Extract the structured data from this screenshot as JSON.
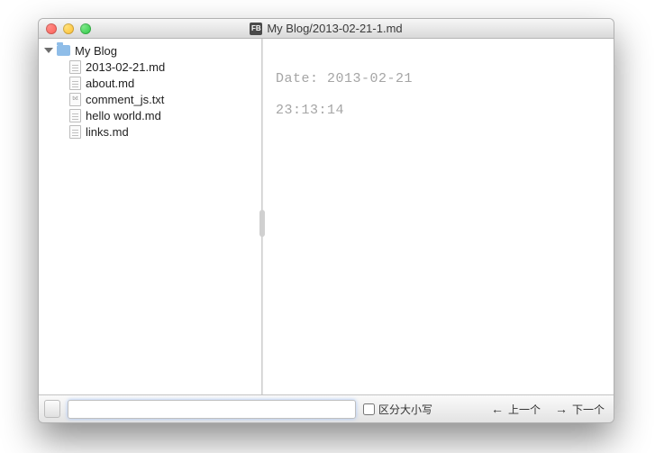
{
  "window": {
    "title": "My Blog/2013-02-21-1.md"
  },
  "tree": {
    "root": {
      "label": "My Blog"
    },
    "items": [
      {
        "label": "2013-02-21.md",
        "icon": "file"
      },
      {
        "label": "about.md",
        "icon": "file"
      },
      {
        "label": "comment_js.txt",
        "icon": "txt"
      },
      {
        "label": "hello world.md",
        "icon": "file"
      },
      {
        "label": "links.md",
        "icon": "file"
      }
    ]
  },
  "preview": {
    "line1": "Date: 2013-02-21",
    "line2": "23:13:14"
  },
  "bottom": {
    "search_value": "",
    "case_sensitive_label": "区分大小写",
    "prev_label": "上一个",
    "next_label": "下一个"
  }
}
